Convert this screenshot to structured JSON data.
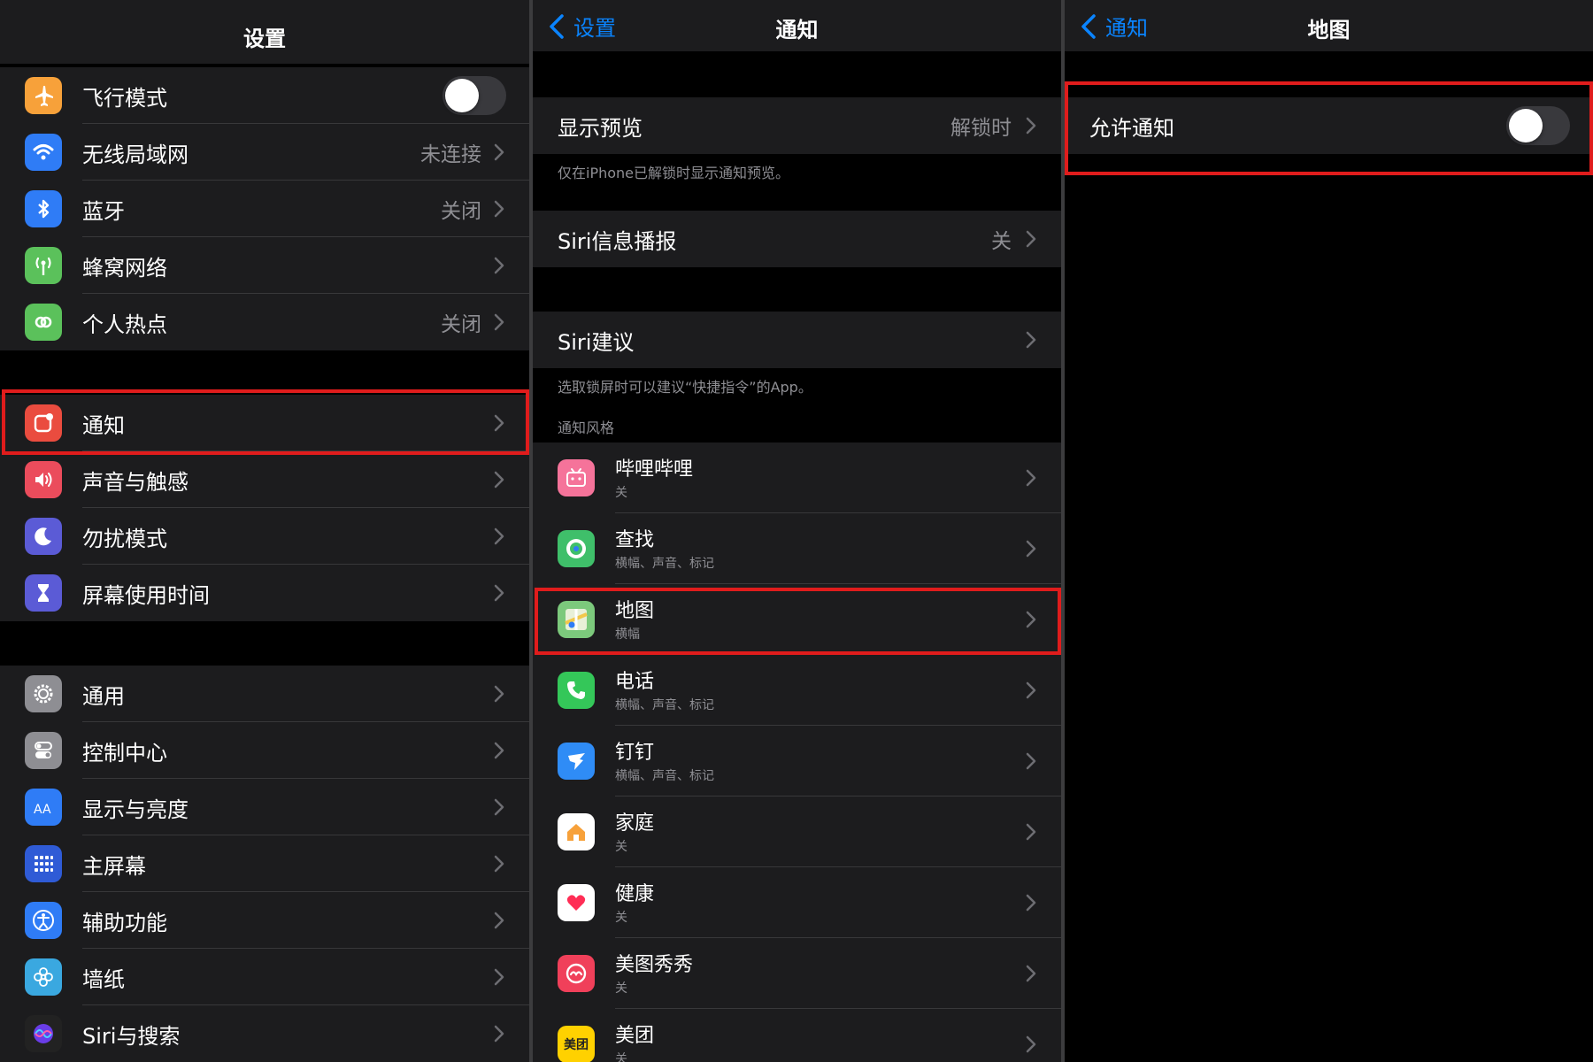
{
  "panel1": {
    "title": "设置",
    "group1": [
      {
        "label": "飞行模式",
        "value": "",
        "icon": "airplane-icon",
        "color": "#f7a13a",
        "toggle": true
      },
      {
        "label": "无线局域网",
        "value": "未连接",
        "icon": "wifi-icon",
        "color": "#2f7cf6"
      },
      {
        "label": "蓝牙",
        "value": "关闭",
        "icon": "bluetooth-icon",
        "color": "#2f7cf6"
      },
      {
        "label": "蜂窝网络",
        "value": "",
        "icon": "antenna-icon",
        "color": "#5bc15b"
      },
      {
        "label": "个人热点",
        "value": "关闭",
        "icon": "hotspot-icon",
        "color": "#5bc15b"
      }
    ],
    "group2": [
      {
        "label": "通知",
        "value": "",
        "icon": "notification-icon",
        "color": "#ea4c3f"
      },
      {
        "label": "声音与触感",
        "value": "",
        "icon": "speaker-icon",
        "color": "#eb4c5c"
      },
      {
        "label": "勿扰模式",
        "value": "",
        "icon": "moon-icon",
        "color": "#5b5bd6"
      },
      {
        "label": "屏幕使用时间",
        "value": "",
        "icon": "hourglass-icon",
        "color": "#5b5bd6"
      }
    ],
    "group3": [
      {
        "label": "通用",
        "value": "",
        "icon": "gear-icon",
        "color": "#8e8e93"
      },
      {
        "label": "控制中心",
        "value": "",
        "icon": "switches-icon",
        "color": "#8e8e93"
      },
      {
        "label": "显示与亮度",
        "value": "",
        "icon": "text-size-icon",
        "color": "#2f7cf6"
      },
      {
        "label": "主屏幕",
        "value": "",
        "icon": "home-grid-icon",
        "color": "#2f5bd6"
      },
      {
        "label": "辅助功能",
        "value": "",
        "icon": "accessibility-icon",
        "color": "#2f7cf6"
      },
      {
        "label": "墙纸",
        "value": "",
        "icon": "flower-icon",
        "color": "#3aa8e0"
      },
      {
        "label": "Siri与搜索",
        "value": "",
        "icon": "siri-icon",
        "color": "#222"
      }
    ]
  },
  "panel2": {
    "back": "设置",
    "title": "通知",
    "preview": {
      "label": "显示预览",
      "value": "解锁时"
    },
    "preview_note": "仅在iPhone已解锁时显示通知预览。",
    "siri_announce": {
      "label": "Siri信息播报",
      "value": "关"
    },
    "siri_suggest": {
      "label": "Siri建议"
    },
    "siri_note": "选取锁屏时可以建议“快捷指令”的App。",
    "style_header": "通知风格",
    "apps": [
      {
        "name": "哔哩哔哩",
        "sub": "关",
        "icon": "bilibili-icon",
        "color": "#f5739a"
      },
      {
        "name": "查找",
        "sub": "横幅、声音、标记",
        "icon": "findmy-icon",
        "color": "#3fbf6a"
      },
      {
        "name": "地图",
        "sub": "横幅",
        "icon": "maps-icon",
        "color": "#7cc97c"
      },
      {
        "name": "电话",
        "sub": "横幅、声音、标记",
        "icon": "phone-icon",
        "color": "#34c759"
      },
      {
        "name": "钉钉",
        "sub": "横幅、声音、标记",
        "icon": "dingtalk-icon",
        "color": "#2f8cf6"
      },
      {
        "name": "家庭",
        "sub": "关",
        "icon": "home-icon",
        "color": "#ffffff"
      },
      {
        "name": "健康",
        "sub": "关",
        "icon": "heart-icon",
        "color": "#ffffff"
      },
      {
        "name": "美图秀秀",
        "sub": "关",
        "icon": "meitu-icon",
        "color": "#f0405a"
      },
      {
        "name": "美团",
        "sub": "关",
        "icon": "meituan-icon",
        "color": "#ffd100",
        "badge": "美团"
      }
    ]
  },
  "panel3": {
    "back": "通知",
    "title": "地图",
    "allow": {
      "label": "允许通知"
    }
  },
  "colors": {
    "accent": "#0a84ff",
    "highlight": "#e01c1c"
  }
}
